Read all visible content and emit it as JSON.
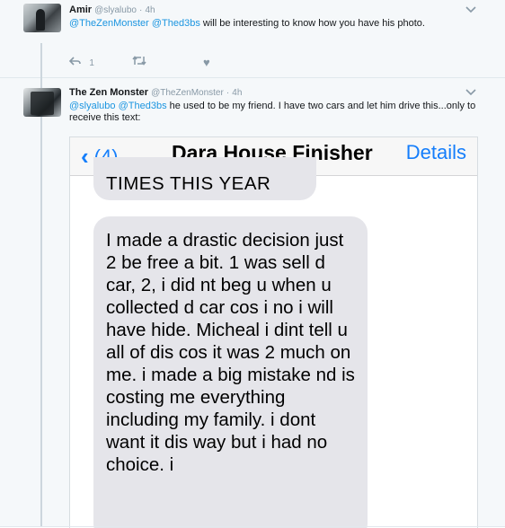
{
  "tweets": [
    {
      "name": "Amir",
      "handle": "@slyalubo",
      "time": "4h",
      "mentions": [
        "@TheZenMonster",
        "@Thed3bs"
      ],
      "text": " will be interesting to know how you have his photo.",
      "reply_count": "1"
    },
    {
      "name": "The Zen Monster",
      "handle": "@TheZenMonster",
      "time": "4h",
      "mentions": [
        "@slyalubo",
        "@Thed3bs"
      ],
      "text": "  he used to be my friend. I have two cars and let him drive this...only to receive this text:"
    }
  ],
  "embedded_screenshot": {
    "back_count": "(4)",
    "contact": "Dara House Finisher",
    "details": "Details",
    "top_message": "TIMES THIS YEAR",
    "main_message": "I made a drastic decision just 2 be free a bit. 1 was sell d car, 2, i did nt beg u when u collected d car cos i no i will have hide. Micheal i dint tell u all of dis cos it was 2 much on me. i made a big mistake nd is costing me everything including my family. i dont want it dis way but i had no choice. i"
  },
  "icons": {
    "reply": "reply-icon",
    "retweet": "retweet-icon",
    "like": "heart-icon",
    "caret": "chevron-down-icon",
    "back": "chevron-left-icon"
  },
  "colors": {
    "mention": "#1b95e0",
    "ios_blue": "#157efb",
    "bubble": "#e5e5ea",
    "meta": "#8899a6"
  }
}
